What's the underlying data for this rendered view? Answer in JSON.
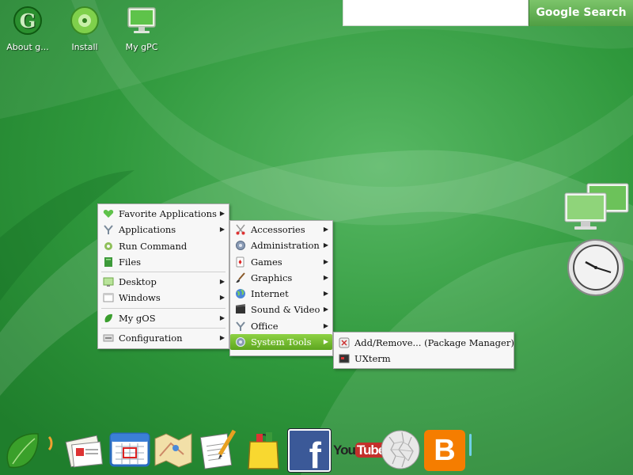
{
  "desktop_icons": [
    {
      "label": "About g..."
    },
    {
      "label": "Install"
    },
    {
      "label": "My gPC"
    }
  ],
  "search": {
    "placeholder": "",
    "button_label": "Google Search"
  },
  "main_menu": {
    "items": [
      {
        "label": "Favorite Applications",
        "icon": "heart-icon",
        "submenu": true
      },
      {
        "label": "Applications",
        "icon": "applications-icon",
        "submenu": true
      },
      {
        "label": "Run Command",
        "icon": "gear-icon",
        "submenu": false
      },
      {
        "label": "Files",
        "icon": "folder-icon",
        "submenu": false
      },
      {
        "label": "Desktop",
        "icon": "desktop-icon",
        "submenu": true
      },
      {
        "label": "Windows",
        "icon": "window-icon",
        "submenu": true
      },
      {
        "label": "My gOS",
        "icon": "leaf-icon",
        "submenu": true
      },
      {
        "label": "Configuration",
        "icon": "config-icon",
        "submenu": true
      }
    ]
  },
  "apps_menu": {
    "items": [
      {
        "label": "Accessories",
        "icon": "scissors-icon"
      },
      {
        "label": "Administration",
        "icon": "cog-icon"
      },
      {
        "label": "Games",
        "icon": "cards-icon"
      },
      {
        "label": "Graphics",
        "icon": "brush-icon"
      },
      {
        "label": "Internet",
        "icon": "globe-icon"
      },
      {
        "label": "Sound & Video",
        "icon": "film-icon"
      },
      {
        "label": "Office",
        "icon": "office-icon"
      },
      {
        "label": "System Tools",
        "icon": "tools-icon",
        "selected": true
      }
    ]
  },
  "system_tools_menu": {
    "items": [
      {
        "label": "Add/Remove... (Package Manager)",
        "icon": "package-icon"
      },
      {
        "label": "UXterm",
        "icon": "terminal-icon"
      }
    ]
  },
  "dock": [
    {
      "name": "gos-leaf"
    },
    {
      "name": "news"
    },
    {
      "name": "calendar"
    },
    {
      "name": "maps"
    },
    {
      "name": "docs"
    },
    {
      "name": "shopping"
    },
    {
      "name": "facebook"
    },
    {
      "name": "youtube"
    },
    {
      "name": "wikipedia"
    },
    {
      "name": "blogger"
    }
  ],
  "dock_text": {
    "facebook": "f",
    "youtube_you": "You",
    "youtube_tube": "Tube",
    "blogger": "B"
  },
  "colors": {
    "menu_highlight": "#6fb52c",
    "google_button": "#5aa84a",
    "desktop": "#2f9a3c"
  }
}
